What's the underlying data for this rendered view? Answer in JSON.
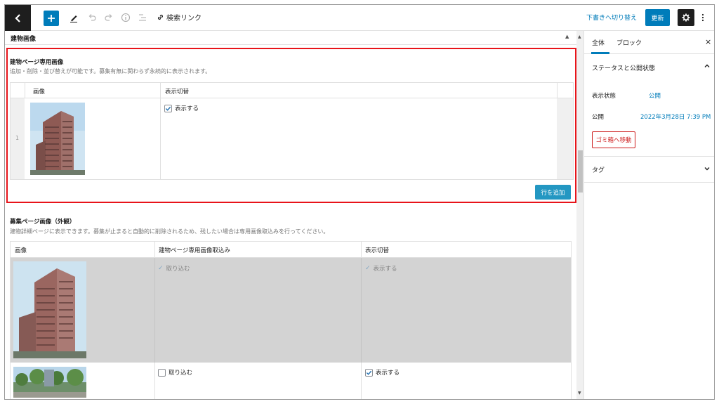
{
  "toolbar": {
    "search_link_label": "検索リンク",
    "draft_label": "下書きへ切り替え",
    "update_label": "更新"
  },
  "section": {
    "title": "建物画像"
  },
  "field1": {
    "label": "建物ページ専用画像",
    "description": "追加・削除・並び替えが可能です。募集有無に関わらず永続的に表示されます。",
    "columns": [
      "画像",
      "表示切替"
    ],
    "rows": [
      {
        "index": "1",
        "display_label": "表示する",
        "display_checked": true
      }
    ],
    "add_row_label": "行を追加"
  },
  "field2": {
    "label": "募集ページ画像（外観）",
    "description": "建物詳細ページに表示できます。募集が止まると自動的に削除されるため、残したい場合は専用画像取込みを行ってください。",
    "columns": [
      "画像",
      "建物ページ専用画像取込み",
      "表示切替"
    ],
    "rows": [
      {
        "import_label": "取り込む",
        "import_checked": true,
        "display_label": "表示する",
        "display_checked": true,
        "disabled": true
      },
      {
        "import_label": "取り込む",
        "import_checked": false,
        "display_label": "表示する",
        "display_checked": true,
        "disabled": false
      }
    ]
  },
  "sidebar": {
    "tabs": [
      "全体",
      "ブロック"
    ],
    "active_tab": "全体",
    "status_panel": {
      "title": "ステータスと公開状態",
      "visibility_label": "表示状態",
      "visibility_value": "公開",
      "publish_label": "公開",
      "publish_value": "2022年3月28日 7:39 PM",
      "trash_label": "ゴミ箱へ移動"
    },
    "tags_panel": {
      "title": "タグ"
    }
  },
  "colors": {
    "accent": "#007cba",
    "highlight_border": "#e8141a",
    "trash": "#cc1818",
    "add_row_button": "#2397c2"
  }
}
